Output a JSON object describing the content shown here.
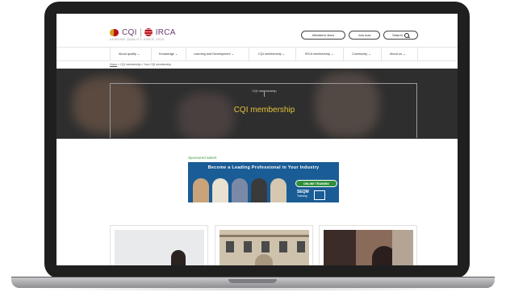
{
  "logo": {
    "cqi": "CQI",
    "irca": "IRCA",
    "tagline": "LEADING QUALITY SINCE 1919"
  },
  "header": {
    "members_area": "Members' Area",
    "join_now": "Join now",
    "search": "Search"
  },
  "nav": [
    {
      "label": "About quality"
    },
    {
      "label": "Knowledge"
    },
    {
      "label": "Learning and Development"
    },
    {
      "label": "CQI membership"
    },
    {
      "label": "IRCA membership"
    },
    {
      "label": "Community"
    },
    {
      "label": "About us"
    }
  ],
  "breadcrumb": {
    "home": "Home",
    "sep": ">",
    "level1": "CQI membership",
    "current": "Your CQI membership"
  },
  "hero": {
    "tag": "CQI membership",
    "title": "CQI membership"
  },
  "sponsored": {
    "label": "Sponsored advert",
    "headline": "Become a Leading Professional in Your Industry",
    "badge": "ONLINE TRAINING",
    "brand": "SEQM",
    "brand_sub": "Training"
  },
  "colors": {
    "accent_gold": "#e3c23a",
    "ad_blue": "#1a5c96",
    "sponsor_green": "#3f9b3f"
  },
  "icons": {
    "chevron": "chevron-down-icon",
    "search": "search-icon"
  }
}
